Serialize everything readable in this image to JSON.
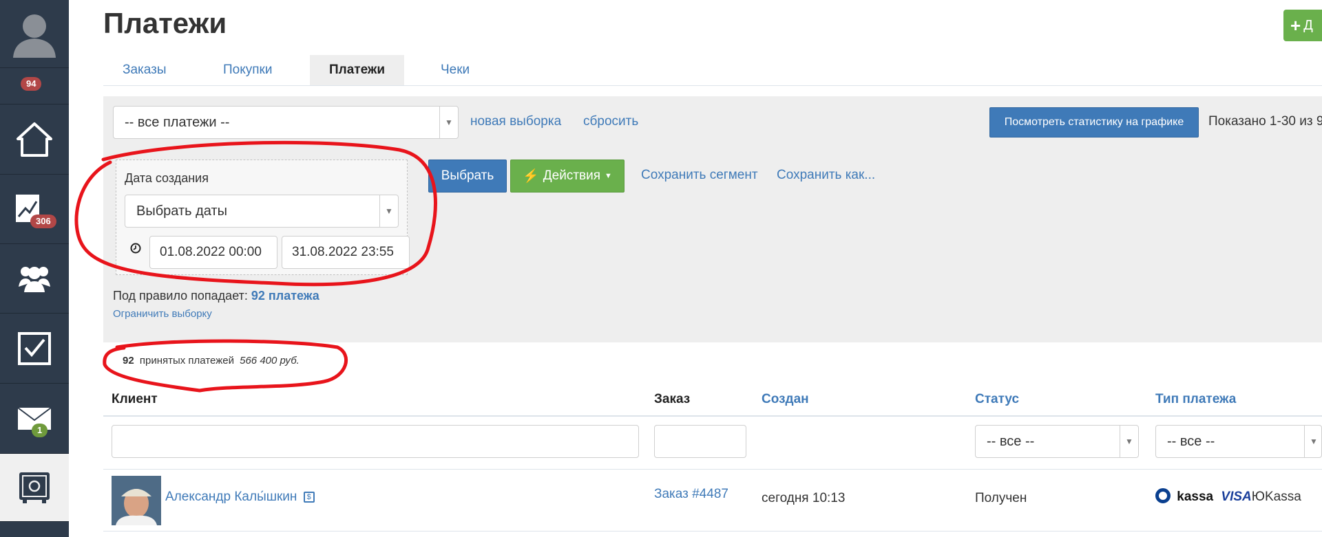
{
  "sidebar": {
    "badges": {
      "top": "94",
      "analytics": "306",
      "mail": "1"
    },
    "icons": [
      "user-avatar-icon",
      "home-icon",
      "chart-icon",
      "users-icon",
      "tasks-icon",
      "mail-icon",
      "safe-icon"
    ]
  },
  "page": {
    "title": "Платежи",
    "add_button": "Д"
  },
  "tabs": [
    {
      "label": "Заказы",
      "active": false
    },
    {
      "label": "Покупки",
      "active": false
    },
    {
      "label": "Платежи",
      "active": true
    },
    {
      "label": "Чеки",
      "active": false
    }
  ],
  "filters": {
    "segment_select": "-- все платежи --",
    "new_selection": "новая выборка",
    "reset": "сбросить",
    "stats_button": "Посмотреть статистику на графике",
    "shown": "Показано 1-30 из 9",
    "date_label": "Дата создания",
    "date_select": "Выбрать даты",
    "date_from": "01.08.2022 00:00",
    "date_to": "31.08.2022 23:55",
    "select_button": "Выбрать",
    "actions_button": "Действия",
    "save_segment": "Сохранить сегмент",
    "save_as": "Сохранить как...",
    "rule_text": "Под правило попадает:",
    "rule_count": "92 платежа",
    "limit_link": "Ограничить выборку"
  },
  "summary": {
    "count": "92",
    "label": "принятых платежей",
    "amount": "566 400 руб."
  },
  "table": {
    "headers": {
      "client": "Клиент",
      "order": "Заказ",
      "created": "Создан",
      "status": "Статус",
      "payment_type": "Тип платежа"
    },
    "filter_status": "-- все --",
    "filter_type": "-- все --",
    "rows": [
      {
        "client": "Александр Калы́шкин",
        "order": "Заказ #4487",
        "created": "сегодня 10:13",
        "status": "Получен",
        "payment_logo": "kassa",
        "payment_visa": "VISA",
        "payment_name": "ЮKassa"
      }
    ]
  },
  "colors": {
    "sidebar": "#2e3b4b",
    "link": "#3f7ab8",
    "green": "#6ab04c",
    "badge_red": "#b24747",
    "annotation": "#e8141b"
  }
}
